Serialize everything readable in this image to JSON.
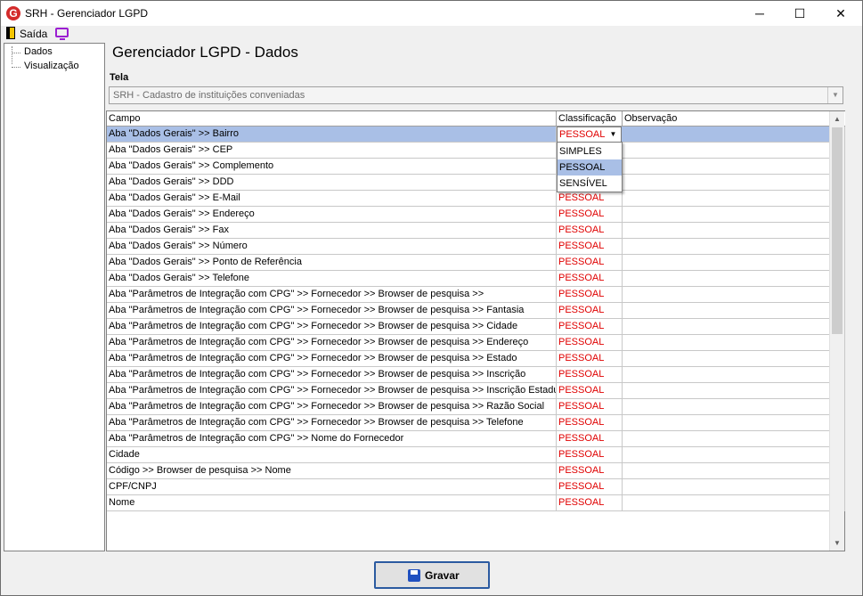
{
  "window": {
    "title": "SRH - Gerenciador LGPD",
    "logo_letter": "G",
    "minimize": "─",
    "maximize": "☐",
    "close": "✕"
  },
  "toolbar": {
    "exit_label": "Saída"
  },
  "tree": {
    "items": [
      "Dados",
      "Visualização"
    ]
  },
  "page_title": "Gerenciador LGPD - Dados",
  "tela": {
    "label": "Tela",
    "value": "SRH - Cadastro de instituições conveniadas",
    "arrow": "▼"
  },
  "grid": {
    "headers": [
      "Campo",
      "Classificação",
      "Observação"
    ],
    "rows": [
      {
        "campo": "Aba \"Dados Gerais\" >> Bairro",
        "classificacao": "PESSOAL",
        "observacao": ""
      },
      {
        "campo": "Aba \"Dados Gerais\" >> CEP",
        "classificacao": "",
        "observacao": ""
      },
      {
        "campo": "Aba \"Dados Gerais\" >> Complemento",
        "classificacao": "",
        "observacao": ""
      },
      {
        "campo": "Aba \"Dados Gerais\" >> DDD",
        "classificacao": "",
        "observacao": ""
      },
      {
        "campo": "Aba \"Dados Gerais\" >> E-Mail",
        "classificacao": "PESSOAL",
        "observacao": ""
      },
      {
        "campo": "Aba \"Dados Gerais\" >> Endereço",
        "classificacao": "PESSOAL",
        "observacao": ""
      },
      {
        "campo": "Aba \"Dados Gerais\" >> Fax",
        "classificacao": "PESSOAL",
        "observacao": ""
      },
      {
        "campo": "Aba \"Dados Gerais\" >> Número",
        "classificacao": "PESSOAL",
        "observacao": ""
      },
      {
        "campo": "Aba \"Dados Gerais\" >> Ponto de Referência",
        "classificacao": "PESSOAL",
        "observacao": ""
      },
      {
        "campo": "Aba \"Dados Gerais\" >> Telefone",
        "classificacao": "PESSOAL",
        "observacao": ""
      },
      {
        "campo": "Aba \"Parâmetros de Integração com CPG\" >> Fornecedor >> Browser de pesquisa >>",
        "classificacao": "PESSOAL",
        "observacao": ""
      },
      {
        "campo": "Aba \"Parâmetros de Integração com CPG\" >> Fornecedor >> Browser de pesquisa >>  Fantasia",
        "classificacao": "PESSOAL",
        "observacao": ""
      },
      {
        "campo": "Aba \"Parâmetros de Integração com CPG\" >> Fornecedor >> Browser de pesquisa >> Cidade",
        "classificacao": "PESSOAL",
        "observacao": ""
      },
      {
        "campo": "Aba \"Parâmetros de Integração com CPG\" >> Fornecedor >> Browser de pesquisa >> Endereço",
        "classificacao": "PESSOAL",
        "observacao": ""
      },
      {
        "campo": "Aba \"Parâmetros de Integração com CPG\" >> Fornecedor >> Browser de pesquisa >> Estado",
        "classificacao": "PESSOAL",
        "observacao": ""
      },
      {
        "campo": "Aba \"Parâmetros de Integração com CPG\" >> Fornecedor >> Browser de pesquisa >> Inscrição",
        "classificacao": "PESSOAL",
        "observacao": ""
      },
      {
        "campo": "Aba \"Parâmetros de Integração com CPG\" >> Fornecedor >> Browser de pesquisa >> Inscrição Estadual",
        "classificacao": "PESSOAL",
        "observacao": ""
      },
      {
        "campo": "Aba \"Parâmetros de Integração com CPG\" >> Fornecedor >> Browser de pesquisa >> Razão Social",
        "classificacao": "PESSOAL",
        "observacao": ""
      },
      {
        "campo": "Aba \"Parâmetros de Integração com CPG\" >> Fornecedor >> Browser de pesquisa >> Telefone",
        "classificacao": "PESSOAL",
        "observacao": ""
      },
      {
        "campo": "Aba \"Parâmetros de Integração com CPG\" >> Nome do Fornecedor",
        "classificacao": "PESSOAL",
        "observacao": ""
      },
      {
        "campo": "Cidade",
        "classificacao": "PESSOAL",
        "observacao": ""
      },
      {
        "campo": "Código >> Browser de pesquisa >> Nome",
        "classificacao": "PESSOAL",
        "observacao": ""
      },
      {
        "campo": "CPF/CNPJ",
        "classificacao": "PESSOAL",
        "observacao": ""
      },
      {
        "campo": "Nome",
        "classificacao": "PESSOAL",
        "observacao": ""
      }
    ],
    "selected_row": 0,
    "editor": {
      "value": "PESSOAL",
      "arrow": "▼"
    },
    "dropdown_options": [
      "SIMPLES",
      "PESSOAL",
      "SENSÍVEL"
    ],
    "dropdown_highlighted": 1,
    "scroll_up": "▲",
    "scroll_down": "▼"
  },
  "save_button": {
    "label": "Gravar"
  },
  "colors": {
    "selection": "#a9bfe6",
    "classification_text": "#e00000",
    "button_border": "#2b5aa0"
  }
}
